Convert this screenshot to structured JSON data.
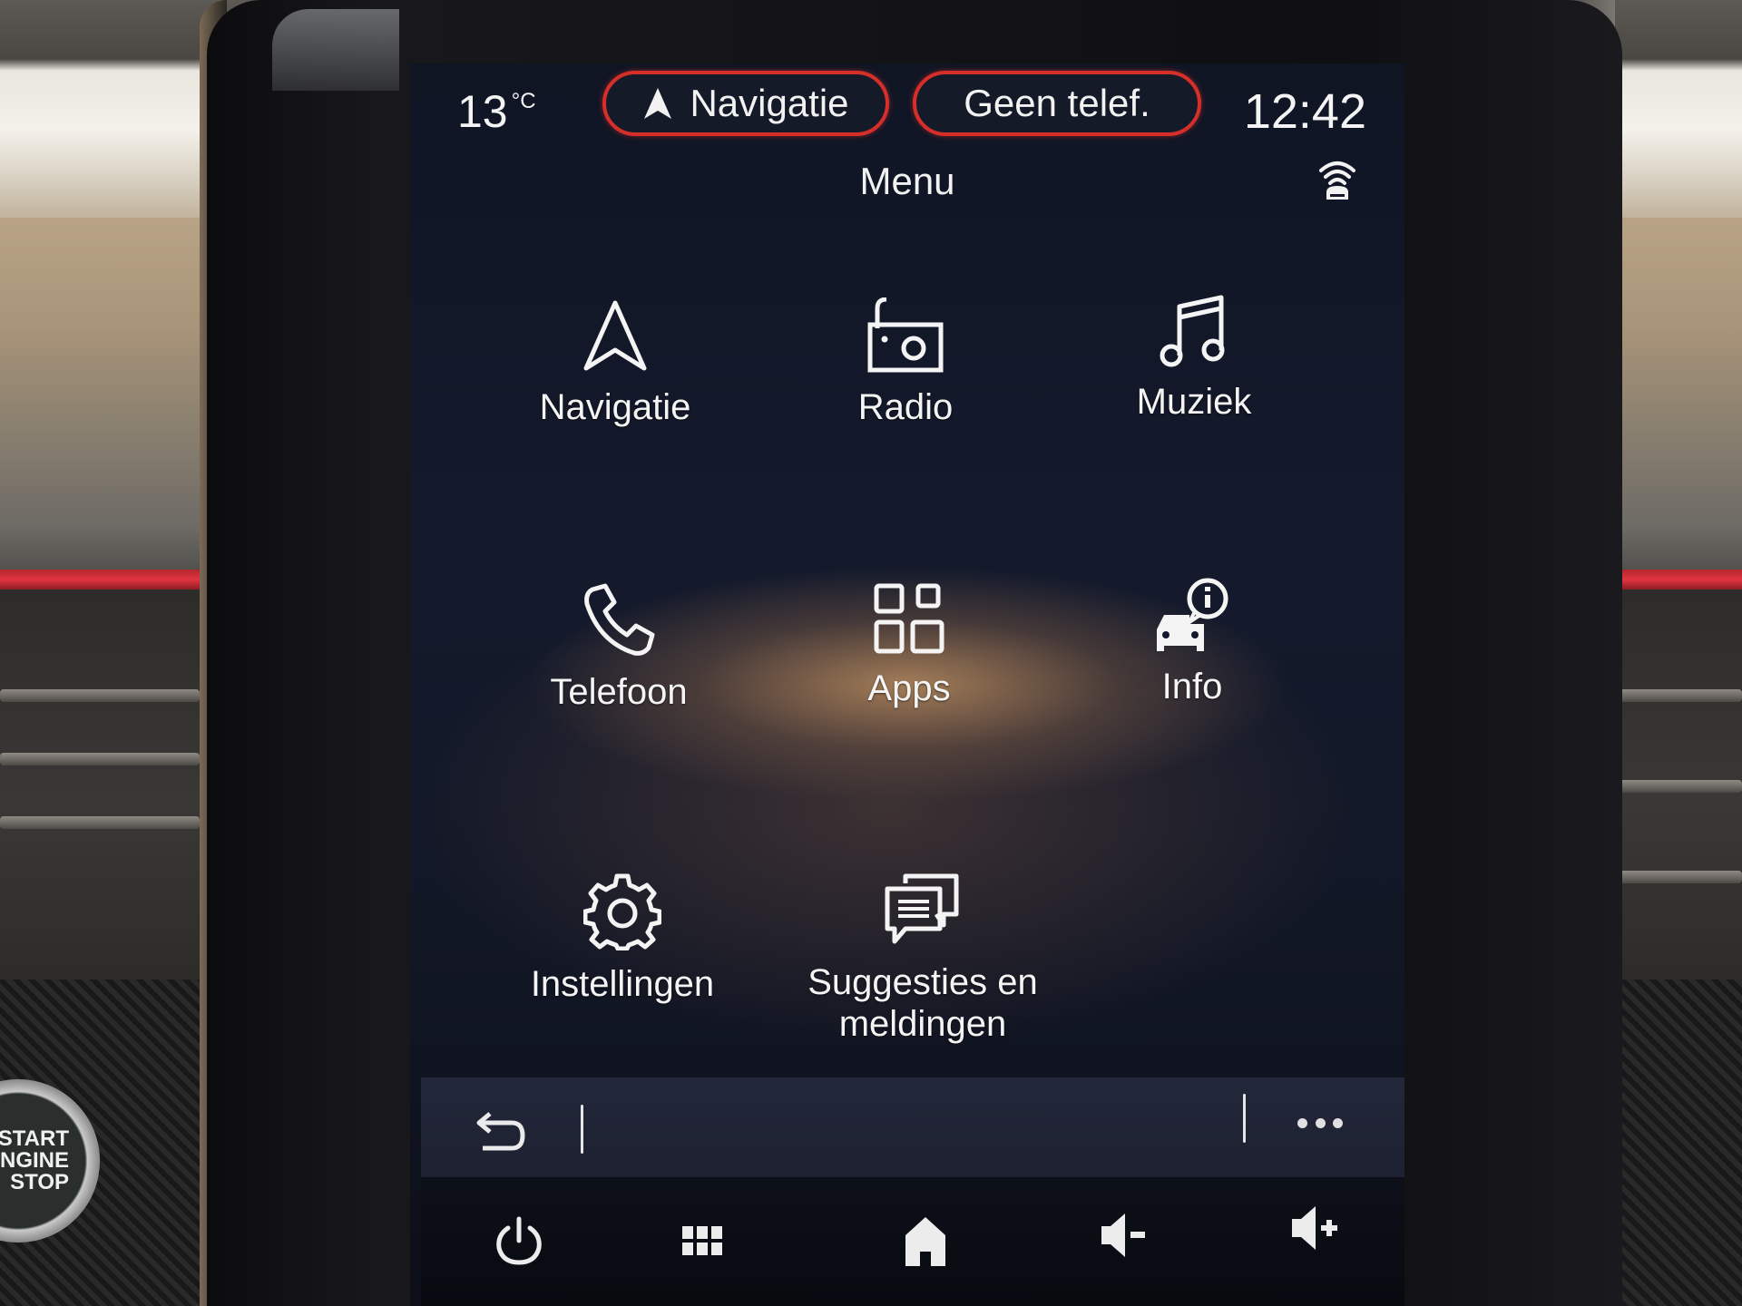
{
  "environment": {
    "start_button_label": "START\nENGINE\nSTOP"
  },
  "status_bar": {
    "temperature": "13",
    "temperature_unit": "°C",
    "navigation_shortcut": {
      "label": "Navigatie",
      "icon": "navigation-arrow-icon"
    },
    "phone_shortcut": {
      "label": "Geen telef."
    },
    "clock": "12:42",
    "accent_color": "#d62f2a"
  },
  "header": {
    "title": "Menu",
    "connectivity_icon": "connected-car-signal-icon"
  },
  "menu_items": [
    {
      "label": "Navigatie",
      "icon": "navigation-arrow-icon"
    },
    {
      "label": "Radio",
      "icon": "radio-icon"
    },
    {
      "label": "Muziek",
      "icon": "music-note-icon"
    },
    {
      "label": "Telefoon",
      "icon": "phone-icon"
    },
    {
      "label": "Apps",
      "icon": "apps-grid-icon"
    },
    {
      "label": "Info",
      "icon": "car-info-icon"
    },
    {
      "label": "Instellingen",
      "icon": "gear-icon"
    },
    {
      "label": "Suggesties en\nmeldingen",
      "icon": "notifications-chat-icon"
    }
  ],
  "action_bar": {
    "back_icon": "back-arrow-icon",
    "more_icon": "more-dots-icon"
  },
  "system_bar": [
    {
      "name": "power",
      "icon": "power-icon"
    },
    {
      "name": "apps-menu",
      "icon": "grid-menu-icon"
    },
    {
      "name": "home",
      "icon": "home-icon"
    },
    {
      "name": "volume-down",
      "icon": "volume-down-icon"
    },
    {
      "name": "volume-up",
      "icon": "volume-up-icon"
    }
  ]
}
